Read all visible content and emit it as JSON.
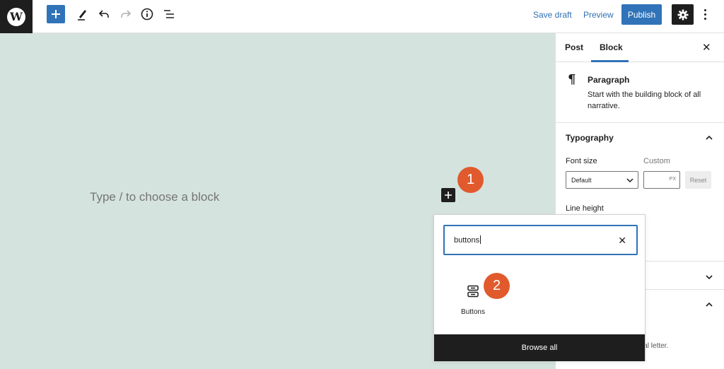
{
  "toolbar": {
    "logo_letter": "W",
    "icons": [
      "add-block-icon",
      "pencil-icon",
      "undo-icon",
      "redo-icon",
      "info-icon",
      "list-view-icon"
    ],
    "save_draft": "Save draft",
    "preview": "Preview",
    "publish": "Publish",
    "settings_icon": "gear-icon",
    "more_icon": "vertical-ellipsis-icon"
  },
  "canvas": {
    "placeholder": "Type / to choose a block",
    "background": "#d5e3df"
  },
  "steps": [
    "1",
    "2"
  ],
  "sidebar": {
    "tabs": [
      "Post",
      "Block"
    ],
    "close": "✕",
    "block": {
      "icon": "¶",
      "title": "Paragraph",
      "description": "Start with the building block of all narrative."
    },
    "typography": {
      "title": "Typography",
      "font_size_label": "Font size",
      "custom_label": "Custom",
      "font_size_value": "Default",
      "unit": "PX",
      "reset": "Reset",
      "line_height_label": "Line height"
    },
    "partial_text": "itial letter."
  },
  "inserter": {
    "search_value": "buttons",
    "clear": "✕",
    "result_label": "Buttons",
    "browse_all": "Browse all"
  },
  "colors": {
    "accent": "#3173b8",
    "step_badge": "#e15a2d",
    "dark": "#1e1e1e"
  }
}
